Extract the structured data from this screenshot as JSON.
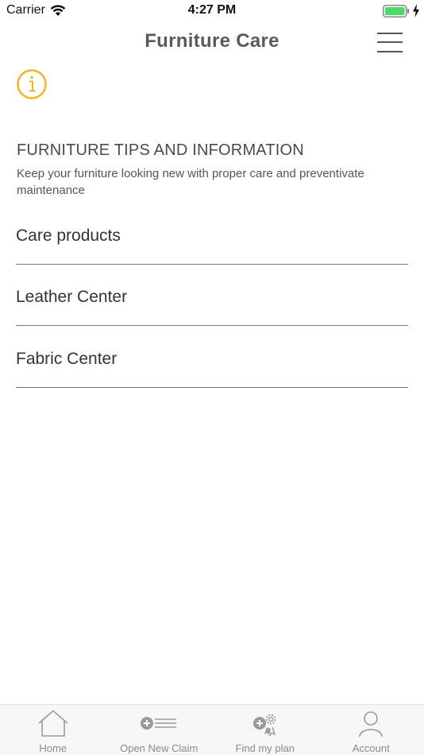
{
  "status_bar": {
    "carrier": "Carrier",
    "time": "4:27 PM",
    "battery_color": "#4cd964"
  },
  "header": {
    "title": "Furniture Care",
    "menu_icon": "hamburger-menu-icon"
  },
  "info": {
    "icon": "info-icon",
    "accent_color": "#f0b429"
  },
  "tips": {
    "heading": "FURNITURE TIPS AND INFORMATION",
    "description": "Keep your furniture looking new with proper care and preventivate maintenance"
  },
  "care_list": [
    {
      "label": "Care products"
    },
    {
      "label": "Leather Center"
    },
    {
      "label": "Fabric Center"
    }
  ],
  "tab_bar": {
    "tabs": [
      {
        "label": "Home",
        "icon": "home-icon"
      },
      {
        "label": "Open New Claim",
        "icon": "new-claim-icon"
      },
      {
        "label": "Find my plan",
        "icon": "find-plan-icon"
      },
      {
        "label": "Account",
        "icon": "account-icon"
      }
    ]
  }
}
